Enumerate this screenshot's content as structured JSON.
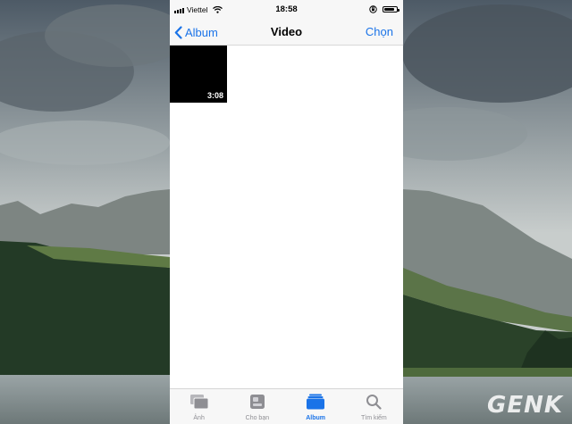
{
  "status_bar": {
    "carrier": "Viettel",
    "time": "18:58"
  },
  "nav_bar": {
    "back_label": "Album",
    "title": "Video",
    "select_label": "Chọn"
  },
  "videos": [
    {
      "duration": "3:08"
    }
  ],
  "tab_bar": {
    "tabs": [
      {
        "label": "Ảnh",
        "icon": "photos-icon",
        "active": false
      },
      {
        "label": "Cho bạn",
        "icon": "for-you-icon",
        "active": false
      },
      {
        "label": "Album",
        "icon": "albums-icon",
        "active": true
      },
      {
        "label": "Tìm kiếm",
        "icon": "search-icon",
        "active": false
      }
    ]
  },
  "watermark": "GENK",
  "colors": {
    "accent": "#1a73e8",
    "inactive": "#8e8e93"
  }
}
